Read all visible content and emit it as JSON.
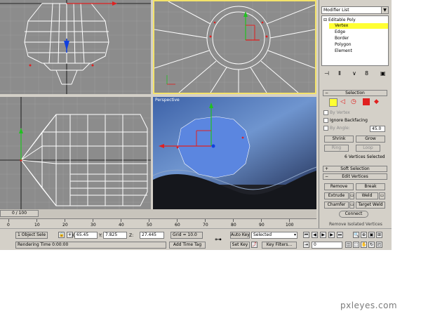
{
  "viewports": {
    "perspective_label": "Perspective"
  },
  "timeline": {
    "frame_indicator": "0 / 100",
    "ruler_ticks": [
      "0",
      "10",
      "20",
      "30",
      "40",
      "50",
      "60",
      "70",
      "80",
      "90",
      "100"
    ]
  },
  "panel": {
    "modifier_list": "Modifier List",
    "stack": [
      {
        "label": "Editable Poly",
        "prefix": "⊟",
        "selected": false
      },
      {
        "label": "Vertex",
        "prefix": "",
        "selected": true
      },
      {
        "label": "Edge",
        "prefix": "",
        "selected": false
      },
      {
        "label": "Border",
        "prefix": "",
        "selected": false
      },
      {
        "label": "Polygon",
        "prefix": "",
        "selected": false
      },
      {
        "label": "Element",
        "prefix": "",
        "selected": false
      }
    ],
    "selection": {
      "header": "Selection",
      "by_vertex": "By Vertex",
      "ignore_backfacing": "Ignore Backfacing",
      "by_angle": "By Angle:",
      "angle_value": "45.0",
      "shrink": "Shrink",
      "grow": "Grow",
      "ring": "Ring",
      "loop": "Loop",
      "status": "6 Vertices Selected"
    },
    "soft_selection": {
      "header": "Soft Selection"
    },
    "edit_vertices": {
      "header": "Edit Vertices",
      "remove": "Remove",
      "break": "Break",
      "extrude": "Extrude",
      "weld": "Weld",
      "chamfer": "Chamfer",
      "target_weld": "Target Weld",
      "connect": "Connect",
      "remove_isolated": "Remove Isolated Vertices"
    }
  },
  "status": {
    "selection_count": "1 Object Sele",
    "x_label": "X:",
    "x_value": "65.45",
    "y_label": "Y:",
    "y_value": "7.825",
    "z_label": "Z:",
    "z_value": "27.445",
    "grid": "Grid = 10.0",
    "rendering_time": "Rendering Time  0:00:00",
    "add_time_tag": "Add Time Tag",
    "auto_key": "Auto Key",
    "selected": "Selected",
    "set_key": "Set Key",
    "key_filters": "Key Filters...",
    "frame_value": "0"
  },
  "watermark": "pxleyes.com",
  "colors": {
    "viewport_bg": "#8c8c8c",
    "active_border": "#f4e36a",
    "selection_yellow": "#ffff33",
    "gizmo_red": "#e02020",
    "gizmo_green": "#20c020",
    "gizmo_blue": "#1040e0",
    "sphere_blue": "#5b86e0",
    "persp_sky": "#3d62a8"
  }
}
